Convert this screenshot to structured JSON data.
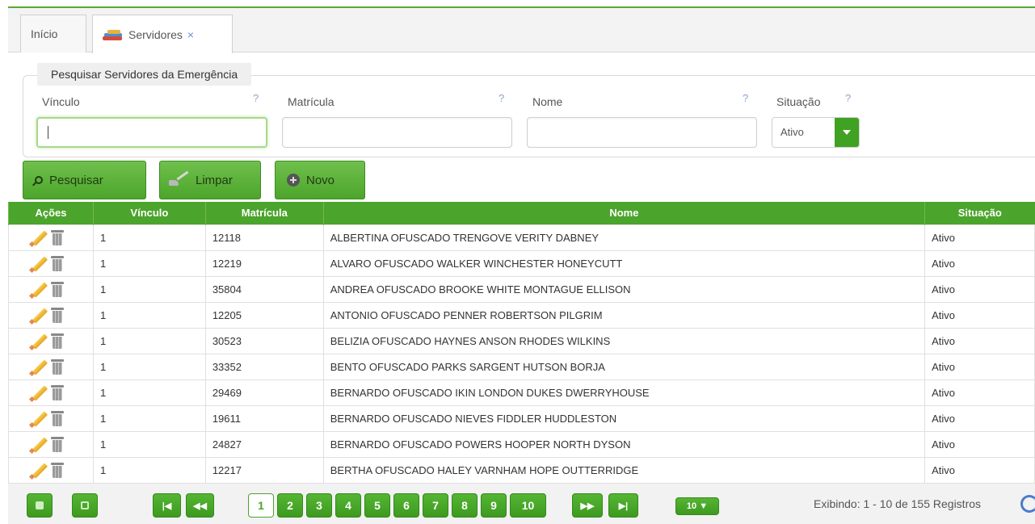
{
  "tabs": [
    {
      "label": "Início"
    },
    {
      "label": "Servidores",
      "close": "×"
    }
  ],
  "search": {
    "legend": "Pesquisar Servidores da Emergência",
    "help": "?",
    "fields": {
      "vinculo": {
        "label": "Vínculo",
        "value": ""
      },
      "matricula": {
        "label": "Matrícula",
        "value": ""
      },
      "nome": {
        "label": "Nome",
        "value": ""
      },
      "situacao": {
        "label": "Situação",
        "value": "Ativo"
      }
    }
  },
  "buttons": {
    "pesquisar": "Pesquisar",
    "limpar": "Limpar",
    "novo": "Novo"
  },
  "table": {
    "columns": [
      "Ações",
      "Vínculo",
      "Matrícula",
      "Nome",
      "Situação"
    ],
    "rows": [
      {
        "vinculo": "1",
        "matricula": "12118",
        "nome": "ALBERTINA OFUSCADO TRENGOVE VERITY DABNEY",
        "situacao": "Ativo"
      },
      {
        "vinculo": "1",
        "matricula": "12219",
        "nome": "ALVARO OFUSCADO WALKER WINCHESTER HONEYCUTT",
        "situacao": "Ativo"
      },
      {
        "vinculo": "1",
        "matricula": "35804",
        "nome": "ANDREA OFUSCADO BROOKE WHITE MONTAGUE ELLISON",
        "situacao": "Ativo"
      },
      {
        "vinculo": "1",
        "matricula": "12205",
        "nome": "ANTONIO OFUSCADO PENNER ROBERTSON PILGRIM",
        "situacao": "Ativo"
      },
      {
        "vinculo": "1",
        "matricula": "30523",
        "nome": "BELIZIA OFUSCADO HAYNES ANSON RHODES WILKINS",
        "situacao": "Ativo"
      },
      {
        "vinculo": "1",
        "matricula": "33352",
        "nome": "BENTO OFUSCADO PARKS SARGENT HUTSON BORJA",
        "situacao": "Ativo"
      },
      {
        "vinculo": "1",
        "matricula": "29469",
        "nome": "BERNARDO OFUSCADO IKIN LONDON DUKES DWERRYHOUSE",
        "situacao": "Ativo"
      },
      {
        "vinculo": "1",
        "matricula": "19611",
        "nome": "BERNARDO OFUSCADO NIEVES FIDDLER HUDDLESTON",
        "situacao": "Ativo"
      },
      {
        "vinculo": "1",
        "matricula": "24827",
        "nome": "BERNARDO OFUSCADO POWERS HOOPER NORTH DYSON",
        "situacao": "Ativo"
      },
      {
        "vinculo": "1",
        "matricula": "12217",
        "nome": "BERTHA OFUSCADO HALEY VARNHAM HOPE OUTTERRIDGE",
        "situacao": "Ativo"
      }
    ]
  },
  "pager": {
    "first": "|◀",
    "prev": "◀◀",
    "pages": [
      "1",
      "2",
      "3",
      "4",
      "5",
      "6",
      "7",
      "8",
      "9",
      "10"
    ],
    "current_page": "1",
    "next": "▶▶",
    "last": "▶|",
    "page_size": "10 ▼",
    "info": "Exibindo: 1 - 10 de 155 Registros"
  },
  "colors": {
    "accent": "#4ba42b",
    "header": "#4ba42b",
    "link": "#6a8fd0"
  },
  "icons": [
    "books-icon",
    "close-icon",
    "help-icon",
    "search-icon",
    "broom-icon",
    "add-icon",
    "pencil-icon",
    "trash-icon",
    "columns-icon",
    "export-icon",
    "refresh-icon"
  ]
}
